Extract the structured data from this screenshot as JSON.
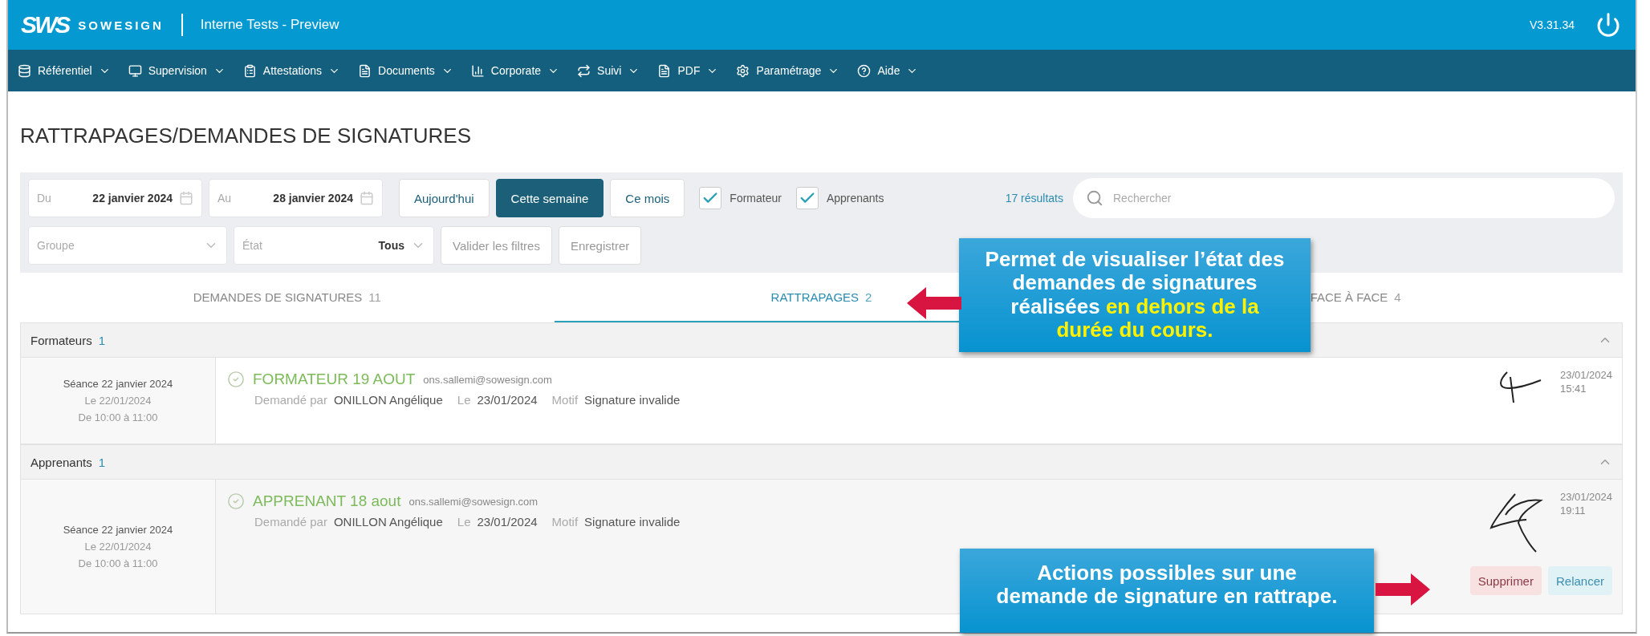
{
  "header": {
    "logo": "SWS",
    "brand": "SOWESIGN",
    "app_title": "Interne Tests - Preview",
    "version": "V3.31.34"
  },
  "nav": [
    {
      "label": "Référentiel"
    },
    {
      "label": "Supervision"
    },
    {
      "label": "Attestations"
    },
    {
      "label": "Documents"
    },
    {
      "label": "Corporate"
    },
    {
      "label": "Suivi"
    },
    {
      "label": "PDF"
    },
    {
      "label": "Paramétrage"
    },
    {
      "label": "Aide"
    }
  ],
  "page_title": "RATTRAPAGES/DEMANDES DE SIGNATURES",
  "filters": {
    "date_from": {
      "label": "Du",
      "value": "22 janvier 2024"
    },
    "date_to": {
      "label": "Au",
      "value": "28 janvier 2024"
    },
    "periods": [
      {
        "label": "Aujourd'hui",
        "selected": false
      },
      {
        "label": "Cette semaine",
        "selected": true
      },
      {
        "label": "Ce mois",
        "selected": false
      }
    ],
    "checkboxes": [
      {
        "label": "Formateur",
        "checked": true
      },
      {
        "label": "Apprenants",
        "checked": true
      }
    ],
    "results": "17 résultats",
    "search": {
      "placeholder": "Rechercher"
    },
    "group_select": {
      "placeholder": "Groupe"
    },
    "state_select": {
      "label": "État",
      "value": "Tous"
    },
    "actions": [
      "Valider les filtres",
      "Enregistrer"
    ]
  },
  "tabs": [
    {
      "label": "DEMANDES DE SIGNATURES",
      "count": "11",
      "selected": false
    },
    {
      "label": "RATTRAPAGES",
      "count": "2",
      "selected": true
    },
    {
      "label": "FACE À FACE",
      "count": "4",
      "selected": false
    }
  ],
  "sections": [
    {
      "title": "Formateurs",
      "count": "1",
      "expanded": true,
      "rows": [
        {
          "session": "Séance 22 janvier 2024",
          "date": "Le 22/01/2024",
          "time": "De 10:00 à 11:00",
          "name": "FORMATEUR 19 AOUT",
          "email": "ons.sallemi@sowesign.com",
          "requested_by_label": "Demandé par",
          "requested_by": "ONILLON Angélique",
          "date_label": "Le",
          "request_date": "23/01/2024",
          "reason_label": "Motif",
          "reason": "Signature invalide",
          "signed_date": "23/01/2024",
          "signed_time": "15:41",
          "highlighted": false,
          "actions": []
        }
      ]
    },
    {
      "title": "Apprenants",
      "count": "1",
      "expanded": true,
      "rows": [
        {
          "session": "Séance 22 janvier 2024",
          "date": "Le 22/01/2024",
          "time": "De 10:00 à 11:00",
          "name": "APPRENANT 18 aout",
          "email": "ons.sallemi@sowesign.com",
          "requested_by_label": "Demandé par",
          "requested_by": "ONILLON Angélique",
          "date_label": "Le",
          "request_date": "23/01/2024",
          "reason_label": "Motif",
          "reason": "Signature invalide",
          "signed_date": "23/01/2024",
          "signed_time": "19:11",
          "highlighted": true,
          "actions": [
            {
              "label": "Supprimer",
              "kind": "danger"
            },
            {
              "label": "Relancer",
              "kind": "info"
            }
          ]
        }
      ]
    }
  ],
  "callouts": [
    {
      "text": "Permet de visualiser l’état des demandes de signatures réalisées ",
      "highlight": "en dehors de la durée du cours."
    },
    {
      "text": "Actions possibles sur une demande de signature en rattrape."
    }
  ]
}
